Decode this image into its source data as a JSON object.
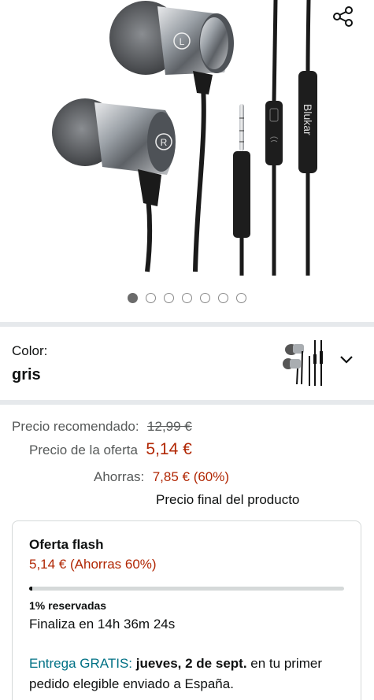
{
  "product": {
    "image_icons": {
      "brand_text": "Blukar",
      "left_marker": "L",
      "right_marker": "R"
    },
    "carousel": {
      "count": 7,
      "active_index": 0
    }
  },
  "share_icon": "share-icon",
  "color": {
    "label": "Color:",
    "value": "gris",
    "chevron_icon": "chevron-down-icon"
  },
  "pricing": {
    "recommended_label": "Precio recomendado:",
    "recommended_value": "12,99 €",
    "offer_label": "Precio de la oferta",
    "offer_value": "5,14 €",
    "savings_label": "Ahorras:",
    "savings_value": "7,85 € (60%)",
    "final_note": "Precio final del producto"
  },
  "flash_deal": {
    "title": "Oferta flash",
    "price_text": "5,14 € (Ahorras 60%)",
    "reserved_fraction": 0.01,
    "reserved_text": "1% reservadas",
    "ends_text": "Finaliza en 14h 36m 24s"
  },
  "delivery": {
    "prefix": "Entrega GRATIS:",
    "date": "jueves, 2 de sept.",
    "suffix": "en tu primer pedido elegible enviado a España."
  },
  "colors": {
    "price_red": "#b12704",
    "link_teal": "#007185",
    "divider": "#e6e9ec"
  }
}
